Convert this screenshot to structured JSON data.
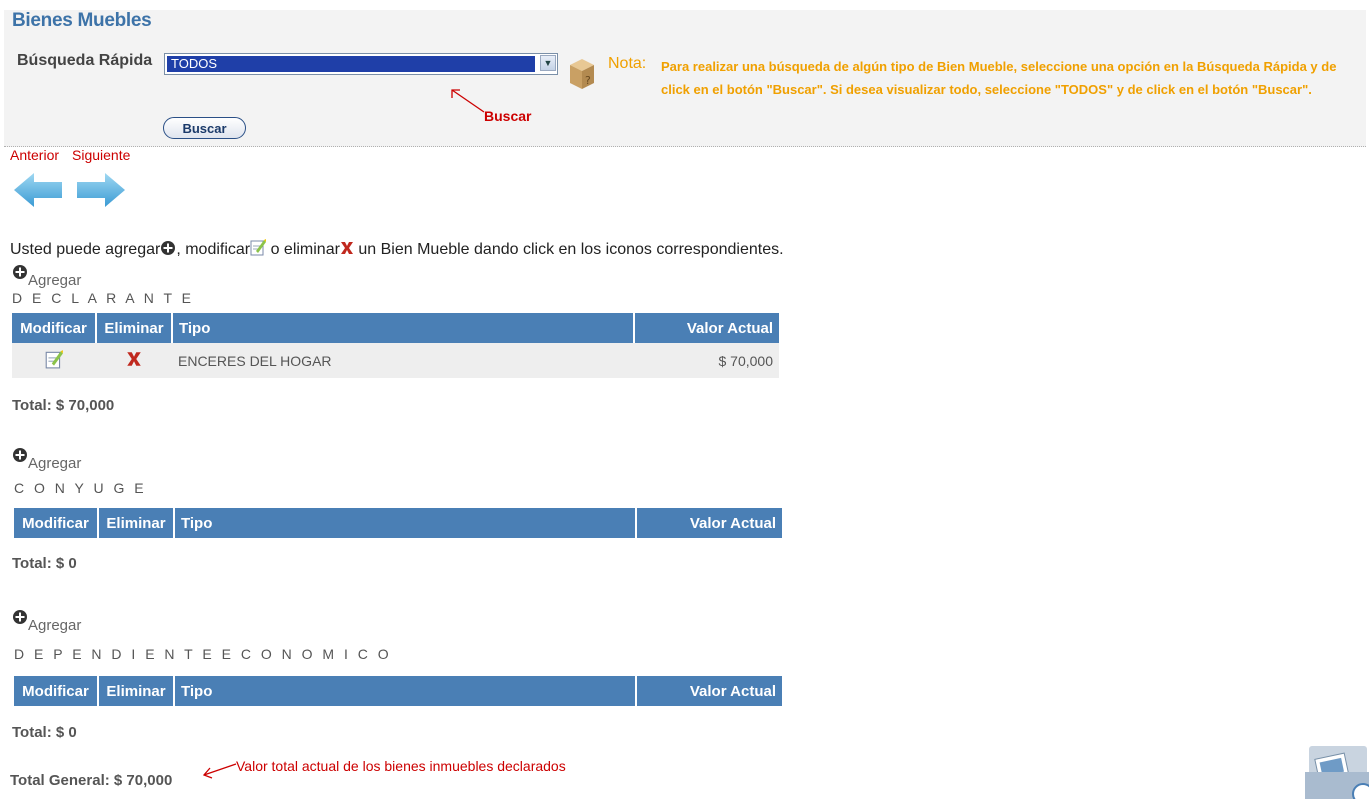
{
  "page": {
    "title": "Bienes Muebles"
  },
  "search": {
    "label": "Búsqueda Rápida",
    "selected_value": "TODOS",
    "button_label": "Buscar",
    "annotation": "Buscar",
    "nota_label": "Nota:",
    "nota_text": "Para realizar una búsqueda de algún tipo de Bien Mueble, seleccione una opción en la Búsqueda Rápida y de click en el botón \"Buscar\". Si desea visualizar todo, seleccione \"TODOS\" y de click en el botón \"Buscar\"."
  },
  "nav": {
    "prev_label": "Anterior",
    "next_label": "Siguiente"
  },
  "intro": {
    "part1": "Usted puede agregar",
    "part2": ", modificar",
    "part3": " o eliminar",
    "part4": " un Bien Mueble dando click en los iconos correspondientes."
  },
  "table_headers": {
    "modificar": "Modificar",
    "eliminar": "Eliminar",
    "tipo": "Tipo",
    "valor": "Valor Actual"
  },
  "sections": [
    {
      "add_label": "Agregar",
      "label": "D E C L A R A N T E",
      "rows": [
        {
          "tipo": "ENCERES DEL HOGAR",
          "valor": "$ 70,000"
        }
      ],
      "total": "Total: $ 70,000"
    },
    {
      "add_label": "Agregar",
      "label": "C O N Y U G E",
      "rows": [],
      "total": "Total: $ 0"
    },
    {
      "add_label": "Agregar",
      "label": "D E P E N D I E N T E  E C O N O M I C O",
      "rows": [],
      "total": "Total: $ 0"
    }
  ],
  "general": {
    "total": "Total General: $ 70,000",
    "annotation": "Valor total actual de los bienes inmuebles declarados"
  },
  "colors": {
    "accent": "#4a7fb5",
    "title": "#3d73a8",
    "note": "#f0a000",
    "annotation": "#cc0000"
  }
}
